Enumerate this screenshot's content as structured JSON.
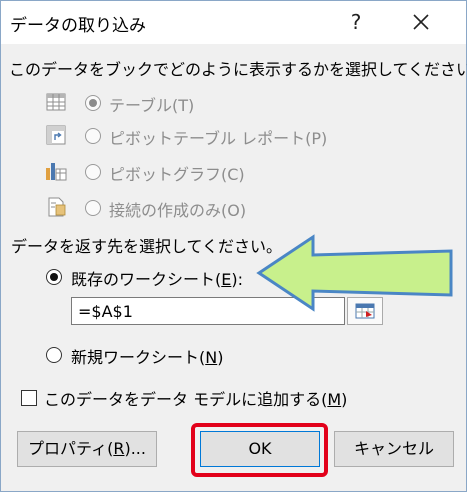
{
  "dialog": {
    "title": "データの取り込み",
    "help_glyph": "?",
    "close_glyph": "✕"
  },
  "display_section": {
    "prompt": "このデータをブックでどのように表示するかを選択してください。",
    "options": [
      {
        "label": "テーブル(T)",
        "icon": "table-icon",
        "selected": true,
        "enabled": false
      },
      {
        "label": "ピボットテーブル レポート(P)",
        "icon": "pivot-table-icon",
        "selected": false,
        "enabled": false
      },
      {
        "label": "ピボットグラフ(C)",
        "icon": "pivot-chart-icon",
        "selected": false,
        "enabled": false
      },
      {
        "label": "接続の作成のみ(O)",
        "icon": "connection-only-icon",
        "selected": false,
        "enabled": false
      }
    ]
  },
  "destination_section": {
    "prompt": "データを返す先を選択してください。",
    "existing_sheet": {
      "label_pre": "既存のワークシート(",
      "label_key": "E",
      "label_post": "):",
      "selected": true
    },
    "cell_reference": "=$A$1",
    "new_sheet": {
      "label_pre": "新規ワークシート(",
      "label_key": "N",
      "label_post": ")",
      "selected": false
    }
  },
  "data_model": {
    "label_pre": "このデータをデータ モデルに追加する(",
    "label_key": "M",
    "label_post": ")",
    "checked": false
  },
  "buttons": {
    "properties": {
      "label_pre": "プロパティ(",
      "label_key": "R",
      "label_post": ")..."
    },
    "ok": "OK",
    "cancel": "キャンセル"
  },
  "colors": {
    "highlight_border": "#e2001a",
    "arrow_fill": "#c8f08c",
    "arrow_stroke": "#4a86c5"
  }
}
